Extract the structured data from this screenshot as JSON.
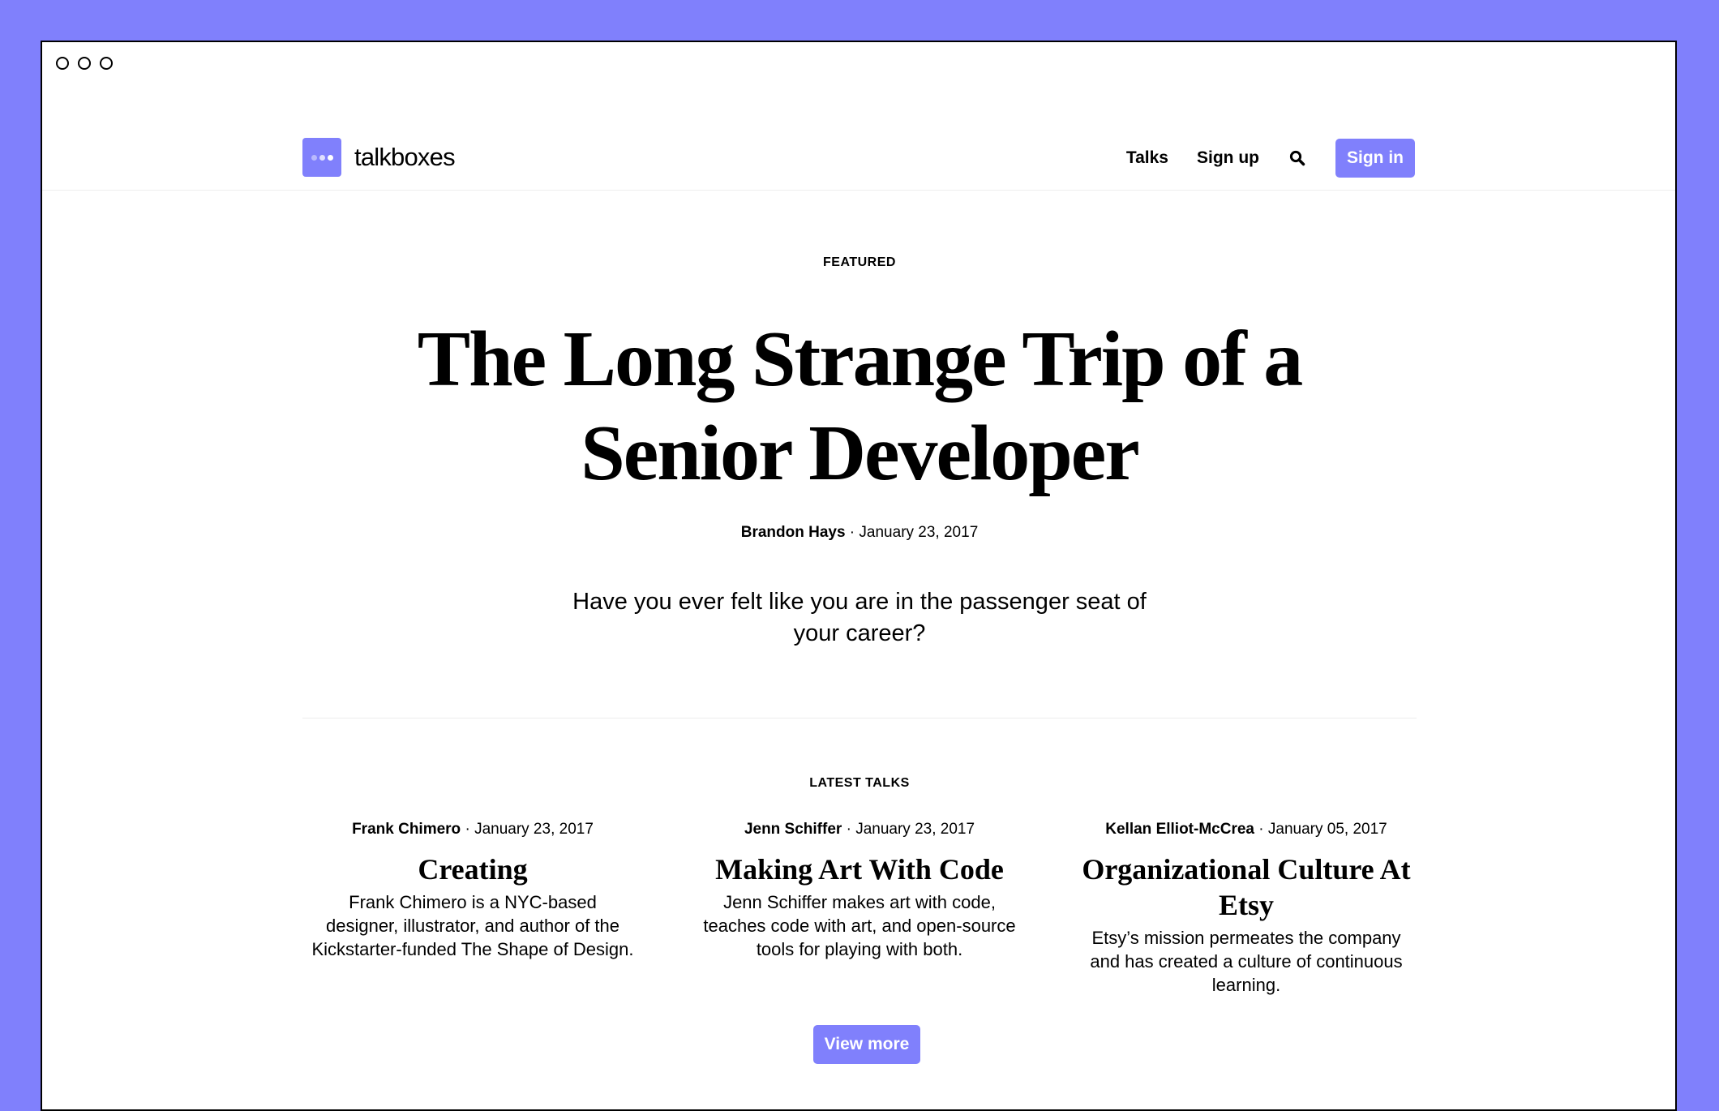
{
  "brand": {
    "name": "talkboxes",
    "accent_color": "#8080fc",
    "logo_icon": "talkboxes-logo-icon"
  },
  "nav": {
    "talks_label": "Talks",
    "signup_label": "Sign up",
    "search_icon": "search-icon",
    "signin_label": "Sign in"
  },
  "featured": {
    "section_label": "FEATURED",
    "title": "The Long Strange Trip of a Senior Developer",
    "author": "Brandon Hays",
    "date": "January 23, 2017",
    "dek": "Have you ever felt like you are in the passenger seat of your career?"
  },
  "latest": {
    "section_label": "LATEST TALKS",
    "talks": [
      {
        "author": "Frank Chimero",
        "date": "January 23, 2017",
        "title": "Creating",
        "description": "Frank Chimero is a NYC-based designer, illustrator, and author of the Kickstarter-funded The Shape of Design."
      },
      {
        "author": "Jenn Schiffer",
        "date": "January 23, 2017",
        "title": "Making Art With Code",
        "description": "Jenn Schiffer makes art with code, teaches code with art, and open-source tools for playing with both."
      },
      {
        "author": "Kellan Elliot-McCrea",
        "date": "January 05, 2017",
        "title": "Organizational Culture At Etsy",
        "description": "Etsy’s mission permeates the company and has created a culture of continuous learning."
      }
    ],
    "view_more_label": "View more"
  }
}
